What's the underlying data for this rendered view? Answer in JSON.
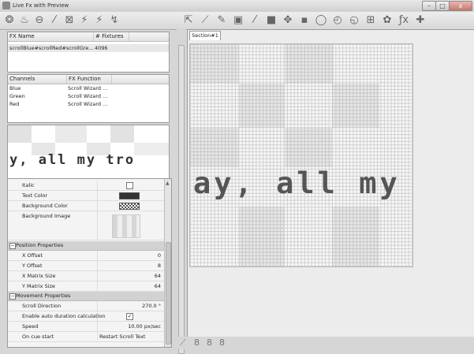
{
  "window": {
    "title": "Live Fx with Preview",
    "min_label": "–",
    "max_label": "□",
    "close_label": "x"
  },
  "toolbar_left": [
    {
      "name": "fx-icon-1",
      "glyph": "❂"
    },
    {
      "name": "fx-icon-2",
      "glyph": "♨"
    },
    {
      "name": "fx-icon-3",
      "glyph": "⊖"
    },
    {
      "name": "wand-icon",
      "glyph": "⁄"
    },
    {
      "name": "wizard-icon",
      "glyph": "⊠"
    },
    {
      "name": "lightning-icon-1",
      "glyph": "⚡"
    },
    {
      "name": "lightning-icon-2",
      "glyph": "⚡"
    },
    {
      "name": "lightning-icon-3",
      "glyph": "↯"
    }
  ],
  "toolbar_right": [
    {
      "name": "pointer-icon",
      "glyph": "⇱"
    },
    {
      "name": "line-icon",
      "glyph": "⟋"
    },
    {
      "name": "brush-icon",
      "glyph": "✎"
    },
    {
      "name": "bucket-icon",
      "glyph": "▣"
    },
    {
      "name": "pen-icon",
      "glyph": "⁄"
    },
    {
      "name": "square-icon",
      "glyph": "■"
    },
    {
      "name": "move-icon",
      "glyph": "✥"
    },
    {
      "name": "rectangle-icon",
      "glyph": "▪"
    },
    {
      "name": "circle-icon",
      "glyph": "◯"
    },
    {
      "name": "ellipse-icon",
      "glyph": "◴"
    },
    {
      "name": "ellipse-fill-icon",
      "glyph": "◵"
    },
    {
      "name": "grid-icon",
      "glyph": "⊞"
    },
    {
      "name": "palette-icon",
      "glyph": "✿"
    },
    {
      "name": "fx-function-icon",
      "glyph": "ƒx"
    },
    {
      "name": "text-icon",
      "glyph": "✚"
    }
  ],
  "fx_table": {
    "headers": [
      "FX Name",
      "# Fixtures"
    ],
    "rows": [
      [
        "scrollBlue#scrollRed#scrollGre...",
        "4096"
      ]
    ]
  },
  "channels_table": {
    "headers": [
      "Channels",
      "FX Function"
    ],
    "rows": [
      [
        "Blue",
        "Scroll Wizard ..."
      ],
      [
        "Green",
        "Scroll Wizard ..."
      ],
      [
        "Red",
        "Scroll Wizard ..."
      ]
    ]
  },
  "preview_text": "y, all my tro",
  "properties": {
    "top_rows": [
      {
        "label": "Italic",
        "kind": "checkbox",
        "checked": false
      },
      {
        "label": "Text Color",
        "kind": "color",
        "color": "#333333"
      },
      {
        "label": "Background Color",
        "kind": "pattern"
      },
      {
        "label": "Background Image",
        "kind": "image"
      }
    ],
    "position_category": "Position Properties",
    "position_rows": [
      {
        "label": "X Offset",
        "value": "0"
      },
      {
        "label": "Y Offset",
        "value": "8"
      },
      {
        "label": "X Matrix Size",
        "value": "64"
      },
      {
        "label": "Y Matrix Size",
        "value": "64"
      }
    ],
    "movement_category": "Movement Properties",
    "movement_rows": [
      {
        "label": "Scroll Direction",
        "value": "270.0 °"
      },
      {
        "label": "Enable auto duration calculation",
        "value": "✓"
      },
      {
        "label": "Speed",
        "value": "10.00 px/sec"
      },
      {
        "label": "On cue start",
        "value": "Restart Scroll Text"
      }
    ]
  },
  "section_tab": "Section#1",
  "matrix_text": "ay, all my tr",
  "splitter_label": "»"
}
